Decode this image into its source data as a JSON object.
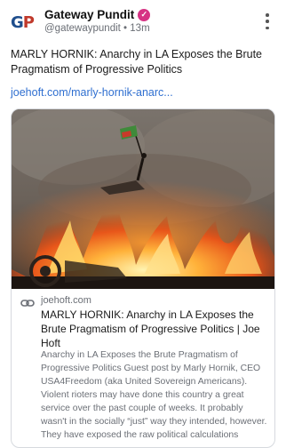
{
  "account": {
    "avatar_text_g": "G",
    "avatar_text_p": "P",
    "name": "Gateway Pundit",
    "handle": "@gatewaypundit",
    "separator": "•",
    "time": "13m",
    "verified_icon": "check-icon",
    "more_icon": "vertical-dots-icon"
  },
  "post": {
    "text": "MARLY HORNIK: Anarchy in LA Exposes the Brute Pragmatism of Progressive Politics",
    "link": "joehoft.com/marly-hornik-anarc..."
  },
  "card": {
    "domain": "joehoft.com",
    "title": "MARLY HORNIK: Anarchy in LA Exposes the Brute Pragmatism of Progressive Politics | Joe Hoft",
    "description": "Anarchy in LA Exposes the Brute Pragmatism of Progressive Politics Guest post by Marly Hornik, CEO USA4Freedom (aka United Sovereign Americans). Violent rioters may have done this country a great service over the past couple of weeks. It probably wasn't in the socially “just” way they intended, however. They have exposed the raw political calculations",
    "link_icon": "link-icon"
  },
  "colors": {
    "link": "#2f6fd0",
    "verified_badge": "#d63384",
    "logo_blue": "#1f4e8c",
    "logo_red": "#c0392b"
  }
}
